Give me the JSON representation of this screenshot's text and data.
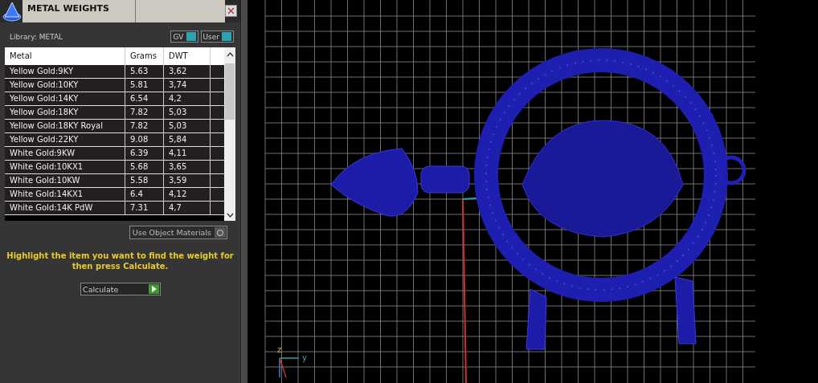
{
  "panel": {
    "title": "METAL WEIGHTS",
    "library_label": "Library: METAL",
    "toggles": [
      {
        "label": "GV",
        "on": true
      },
      {
        "label": "User",
        "on": true
      }
    ],
    "table": {
      "columns": [
        "Metal",
        "Grams",
        "DWT"
      ],
      "rows": [
        {
          "cells": [
            "Yellow Gold:9KY",
            "5.63",
            "3,62"
          ],
          "selected": false
        },
        {
          "cells": [
            "Yellow Gold:10KY",
            "5.81",
            "3,74"
          ],
          "selected": false
        },
        {
          "cells": [
            "Yellow Gold:14KY",
            "6.54",
            "4,2"
          ],
          "selected": false
        },
        {
          "cells": [
            "Yellow Gold:18KY",
            "7.82",
            "5,03"
          ],
          "selected": false
        },
        {
          "cells": [
            "Yellow Gold:18KY Royal",
            "7.82",
            "5,03"
          ],
          "selected": false
        },
        {
          "cells": [
            "Yellow Gold:22KY",
            "9.08",
            "5,84"
          ],
          "selected": false
        },
        {
          "cells": [
            "White Gold:9KW",
            "6.39",
            "4,11"
          ],
          "selected": false
        },
        {
          "cells": [
            "White Gold:10KX1",
            "5.68",
            "3,65"
          ],
          "selected": false
        },
        {
          "cells": [
            "White Gold:10KW",
            "5.58",
            "3,59"
          ],
          "selected": false
        },
        {
          "cells": [
            "White Gold:14KX1",
            "6.4",
            "4,12"
          ],
          "selected": false
        },
        {
          "cells": [
            "White Gold:14K PdW",
            "7.31",
            "4,7"
          ],
          "selected": false
        }
      ]
    },
    "use_object_materials": {
      "label": "Use Object Materials",
      "checked": false
    },
    "hint": "Highlight the item you want to find the weight for then press Calculate.",
    "calculate_button": "Calculate"
  },
  "viewport": {
    "axis_labels": [
      "z",
      "y"
    ]
  }
}
